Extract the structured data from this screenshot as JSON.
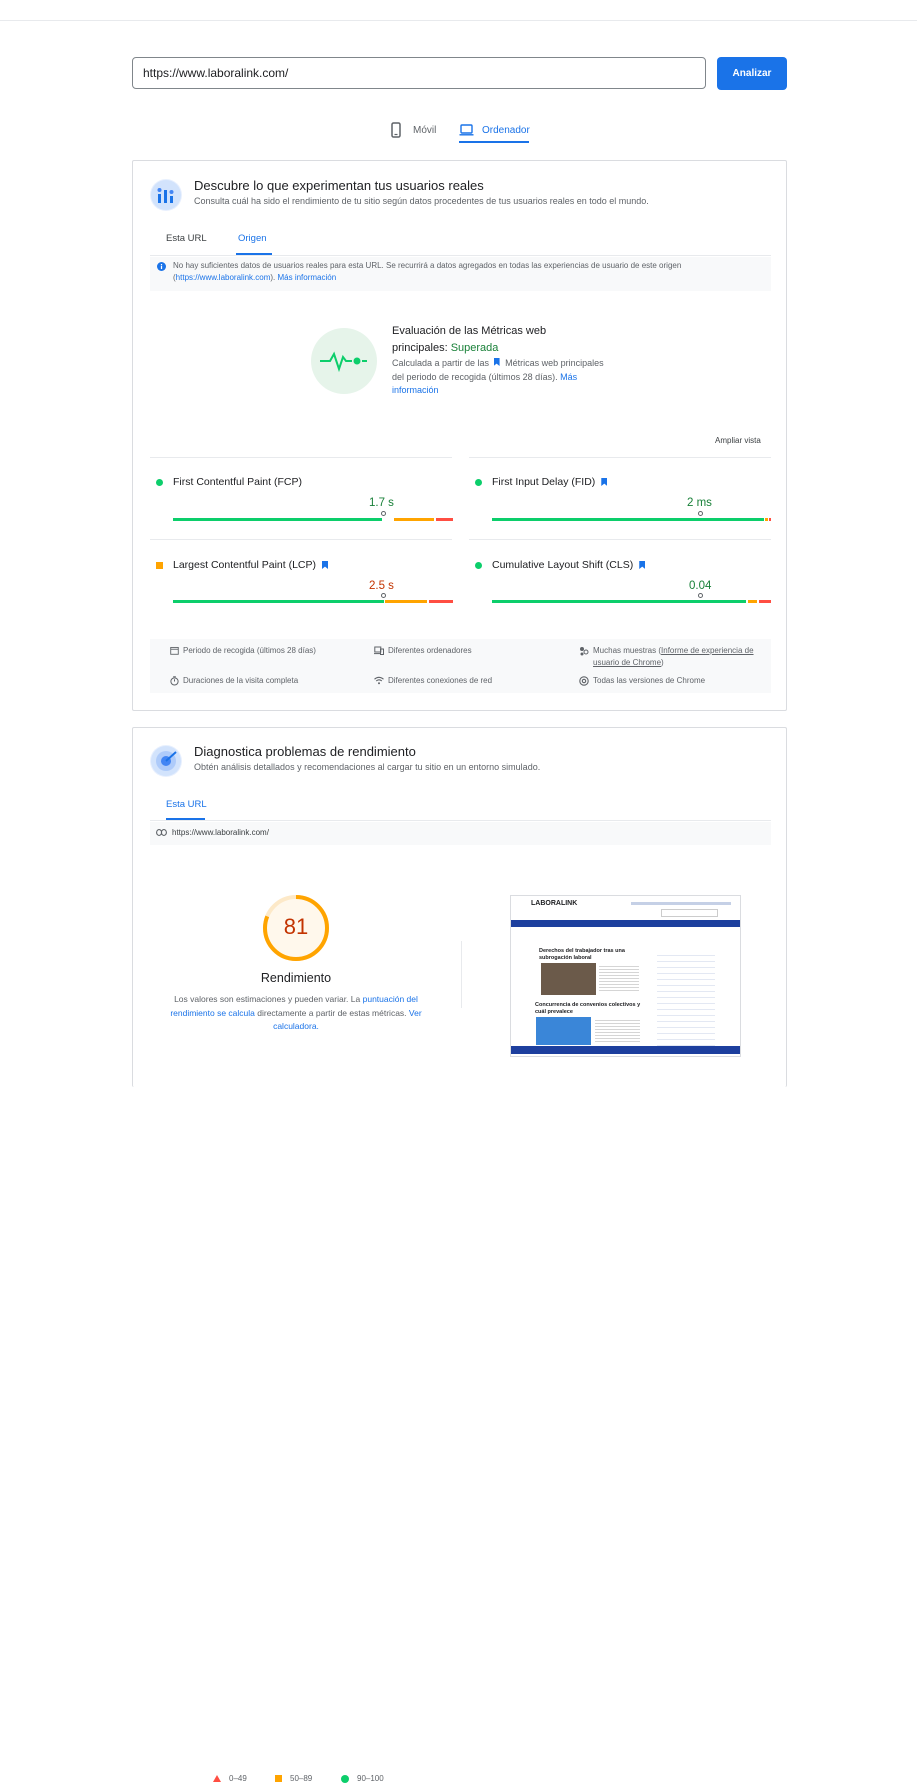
{
  "search": {
    "url_value": "https://www.laboralink.com/",
    "analyze_label": "Analizar"
  },
  "device_tabs": [
    {
      "label": "Móvil",
      "icon": "smartphone-icon",
      "active": false
    },
    {
      "label": "Ordenador",
      "icon": "laptop-icon",
      "active": true
    }
  ],
  "field_data": {
    "title": "Descubre lo que experimentan tus usuarios reales",
    "subtitle": "Consulta cuál ha sido el rendimiento de tu sitio según datos procedentes de tus usuarios reales en todo el mundo.",
    "tabs": [
      {
        "label": "Esta URL",
        "active": false
      },
      {
        "label": "Origen",
        "active": true
      }
    ],
    "notice_text": "No hay suficientes datos de usuarios reales para esta URL. Se recurrirá a datos agregados en todas las experiencias de usuario de este origen (",
    "notice_link": "https://www.laboralink.com",
    "notice_after": "). ",
    "notice_more": "Más información",
    "cwv_title": "Evaluación de las Métricas web principales:",
    "cwv_status": "Superada",
    "cwv_desc_1": "Calculada a partir de las",
    "cwv_desc_2": "Métricas web principales del periodo de recogida (últimos 28 días).",
    "cwv_more": "Más información",
    "expand_view": "Ampliar vista",
    "metrics": [
      {
        "label": "First Contentful Paint (FCP)",
        "value": "1.7 s",
        "status": "good",
        "core": false
      },
      {
        "label": "First Input Delay (FID)",
        "value": "2 ms",
        "status": "good",
        "core": true
      },
      {
        "label": "Largest Contentful Paint (LCP)",
        "value": "2.5 s",
        "status": "average",
        "core": true
      },
      {
        "label": "Cumulative Layout Shift (CLS)",
        "value": "0.04",
        "status": "good",
        "core": true
      }
    ],
    "footer": {
      "period": "Periodo de recogida (últimos 28 días)",
      "devices": "Diferentes ordenadores",
      "samples_prefix": "Muchas muestras (",
      "samples_link": "Informe de experiencia de usuario de Chrome",
      "samples_suffix": ")",
      "durations": "Duraciones de la visita completa",
      "connections": "Diferentes conexiones de red",
      "versions": "Todas las versiones de Chrome"
    }
  },
  "lab_data": {
    "title": "Diagnostica problemas de rendimiento",
    "subtitle": "Obtén análisis detallados y recomendaciones al cargar tu sitio en un entorno simulado.",
    "tab": "Esta URL",
    "url": "https://www.laboralink.com/",
    "score": "81",
    "score_fraction": 0.81,
    "score_label": "Rendimiento",
    "desc_1": "Los valores son estimaciones y pueden variar. La ",
    "desc_link_1": "puntuación del rendimiento se calcula",
    "desc_2": " directamente a partir de estas métricas. ",
    "desc_link_2": "Ver calculadora.",
    "legend": [
      {
        "range": "0–49",
        "shape": "triangle"
      },
      {
        "range": "50–89",
        "shape": "square"
      },
      {
        "range": "90–100",
        "shape": "circle"
      }
    ]
  },
  "thumbnail": {
    "brand": "LABORALINK",
    "headline_1": "Derechos del trabajador tras una subrogación laboral",
    "headline_2": "Concurrencia de convenios colectivos y cuál prevalece"
  },
  "colors": {
    "accent": "#1a73e8",
    "good": "#0cce6b",
    "average": "#ffa400",
    "poor": "#ff4e42",
    "good_text": "#188038",
    "average_text": "#c33300"
  }
}
